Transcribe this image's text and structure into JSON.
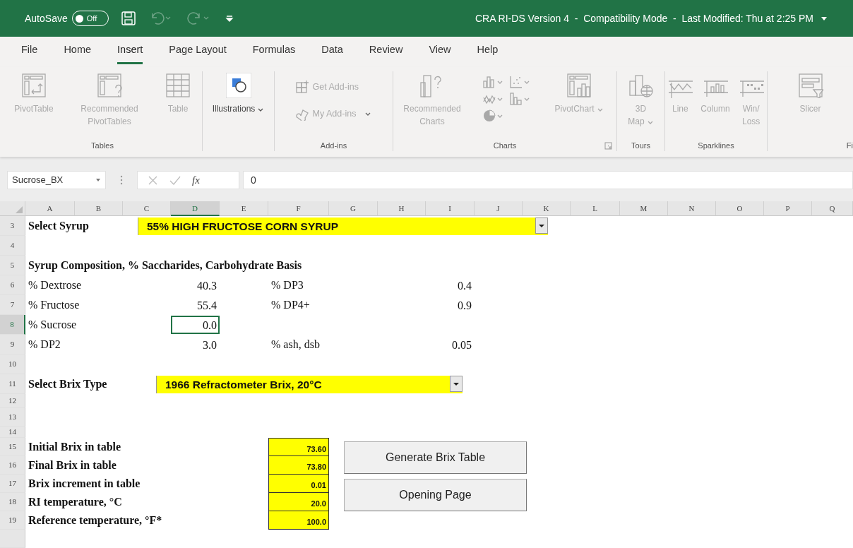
{
  "title_bar": {
    "autosave": {
      "label": "AutoSave",
      "toggle_text": "Off",
      "on": false
    },
    "quick_access": [
      {
        "disabled": false
      },
      {
        "disabled": true
      },
      {
        "disabled": true
      },
      {
        "disabled": false
      }
    ],
    "title": "CRA RI-DS Version 4  -  Compatibility Mode  -  Last Modified: Thu at 2:25 PM"
  },
  "tabs": [
    {
      "label": "File",
      "selected": false
    },
    {
      "label": "Home",
      "selected": false
    },
    {
      "label": "Insert",
      "selected": true
    },
    {
      "label": "Page Layout",
      "selected": false
    },
    {
      "label": "Formulas",
      "selected": false
    },
    {
      "label": "Data",
      "selected": false
    },
    {
      "label": "Review",
      "selected": false
    },
    {
      "label": "View",
      "selected": false
    },
    {
      "label": "Help",
      "selected": false
    }
  ],
  "ribbon": {
    "groups": [
      {
        "label": "Tables",
        "items": [
          {
            "kind": "large",
            "label": "PivotTable",
            "disabled": true,
            "dropdown": false
          },
          {
            "kind": "large",
            "label": "Recommended PivotTables",
            "disabled": true,
            "dropdown": false
          },
          {
            "kind": "large",
            "label": "Table",
            "disabled": true,
            "dropdown": false
          }
        ]
      },
      {
        "items": [
          {
            "kind": "large",
            "label": "Illustrations",
            "disabled": false,
            "dropdown": true
          }
        ]
      },
      {
        "label": "Add-ins",
        "items": [
          {
            "kind": "small",
            "label": "Get Add-ins",
            "disabled": true,
            "dropdown": false
          },
          {
            "kind": "small",
            "label": "My Add-ins",
            "disabled": true,
            "dropdown": true
          }
        ]
      },
      {
        "label": "Charts",
        "launcher": true,
        "items": [
          {
            "kind": "large",
            "label": "Recommended Charts",
            "disabled": true,
            "dropdown": false
          },
          {
            "kind": "gallery",
            "disabled": true
          },
          {
            "kind": "large",
            "label": "PivotChart",
            "disabled": true,
            "dropdown": true
          }
        ]
      },
      {
        "label": "Tours",
        "items": [
          {
            "kind": "large",
            "label": "3D Map",
            "disabled": true,
            "dropdown": true
          }
        ]
      },
      {
        "label": "Sparklines",
        "items": [
          {
            "kind": "large",
            "label": "Line",
            "disabled": true,
            "dropdown": false
          },
          {
            "kind": "large",
            "label": "Column",
            "disabled": true,
            "dropdown": false
          },
          {
            "kind": "large",
            "label": "Win/\nLoss",
            "disabled": true,
            "dropdown": false
          }
        ]
      },
      {
        "label": "Fi",
        "items": [
          {
            "kind": "large",
            "label": "Slicer",
            "disabled": true,
            "dropdown": false
          }
        ]
      }
    ]
  },
  "formula_bar": {
    "name_box": "Sucrose_BX",
    "function_label": "fx",
    "formula": "0"
  },
  "sheet": {
    "columns": [
      {
        "label": "A",
        "selected": false
      },
      {
        "label": "B",
        "selected": false
      },
      {
        "label": "C",
        "selected": false
      },
      {
        "label": "D",
        "selected": true
      },
      {
        "label": "E",
        "selected": false
      },
      {
        "label": "F",
        "selected": false
      },
      {
        "label": "G",
        "selected": false
      },
      {
        "label": "H",
        "selected": false
      },
      {
        "label": "I",
        "selected": false
      },
      {
        "label": "J",
        "selected": false
      },
      {
        "label": "K",
        "selected": false
      },
      {
        "label": "L",
        "selected": false
      },
      {
        "label": "M",
        "selected": false
      },
      {
        "label": "N",
        "selected": false
      },
      {
        "label": "O",
        "selected": false
      },
      {
        "label": "P",
        "selected": false
      },
      {
        "label": "Q",
        "selected": false
      }
    ],
    "rows": [
      {
        "number": "3",
        "selected": false,
        "cells": {
          "A": {
            "kind": "heading",
            "text": "Select Syrup",
            "selected": false
          },
          "C": {
            "kind": "dropdown",
            "text": "55% HIGH FRUCTOSE CORN SYRUP",
            "selected": false
          }
        }
      },
      {
        "number": "4",
        "selected": false
      },
      {
        "number": "5",
        "selected": false,
        "cells": {
          "A": {
            "kind": "heading",
            "text": "Syrup Composition, % Saccharides, Carbohydrate Basis",
            "selected": false
          }
        }
      },
      {
        "number": "6",
        "selected": false,
        "cells": {
          "A": {
            "kind": "label",
            "text": "% Dextrose",
            "selected": false
          },
          "D": {
            "kind": "value",
            "text": "40.3",
            "selected": false
          },
          "F": {
            "kind": "label",
            "text": "% DP3",
            "selected": false
          },
          "I": {
            "kind": "value",
            "text": "0.4",
            "selected": false
          }
        }
      },
      {
        "number": "7",
        "selected": false,
        "cells": {
          "A": {
            "kind": "label",
            "text": "% Fructose",
            "selected": false
          },
          "D": {
            "kind": "value",
            "text": "55.4",
            "selected": false
          },
          "F": {
            "kind": "label",
            "text": "% DP4+",
            "selected": false
          },
          "I": {
            "kind": "value",
            "text": "0.9",
            "selected": false
          }
        }
      },
      {
        "number": "8",
        "selected": true,
        "cells": {
          "A": {
            "kind": "label",
            "text": "% Sucrose",
            "selected": false
          },
          "D": {
            "kind": "value",
            "text": "0.0",
            "selected": true
          }
        }
      },
      {
        "number": "9",
        "selected": false,
        "cells": {
          "A": {
            "kind": "label",
            "text": "% DP2",
            "selected": false
          },
          "D": {
            "kind": "value",
            "text": "3.0",
            "selected": false
          },
          "F": {
            "kind": "label",
            "text": "% ash, dsb",
            "selected": false
          },
          "I": {
            "kind": "value",
            "text": "0.05",
            "selected": false
          }
        }
      },
      {
        "number": "10",
        "selected": false
      },
      {
        "number": "11",
        "selected": false,
        "cells": {
          "A": {
            "kind": "heading",
            "text": "Select Brix Type",
            "selected": false
          },
          "C": {
            "kind": "dropdown",
            "text": "1966 Refractometer Brix, 20°C",
            "selected": false
          }
        }
      },
      {
        "number": "12",
        "selected": false
      },
      {
        "number": "13",
        "selected": false
      },
      {
        "number": "14",
        "selected": false
      },
      {
        "number": "15",
        "selected": false,
        "cells": {
          "A": {
            "kind": "heading",
            "text": "Initial Brix in table",
            "selected": false
          },
          "F": {
            "kind": "input",
            "text": "73.60",
            "selected": false
          }
        }
      },
      {
        "number": "16",
        "selected": false,
        "cells": {
          "A": {
            "kind": "heading",
            "text": "Final Brix in table",
            "selected": false
          },
          "F": {
            "kind": "input",
            "text": "73.80",
            "selected": false
          }
        }
      },
      {
        "number": "17",
        "selected": false,
        "cells": {
          "A": {
            "kind": "heading",
            "text": "Brix increment in table",
            "selected": false
          },
          "F": {
            "kind": "input",
            "text": "0.01",
            "selected": false
          }
        }
      },
      {
        "number": "18",
        "selected": false,
        "cells": {
          "A": {
            "kind": "heading",
            "text": "RI temperature, °C",
            "selected": false
          },
          "F": {
            "kind": "input",
            "text": "20.0",
            "selected": false
          }
        }
      },
      {
        "number": "19",
        "selected": false,
        "cells": {
          "A": {
            "kind": "heading",
            "text": "Reference temperature, °F*",
            "selected": false
          },
          "F": {
            "kind": "input",
            "text": "100.0",
            "selected": false
          }
        }
      }
    ],
    "buttons": [
      {
        "label": "Generate Brix Table"
      },
      {
        "label": "Opening Page"
      }
    ]
  }
}
